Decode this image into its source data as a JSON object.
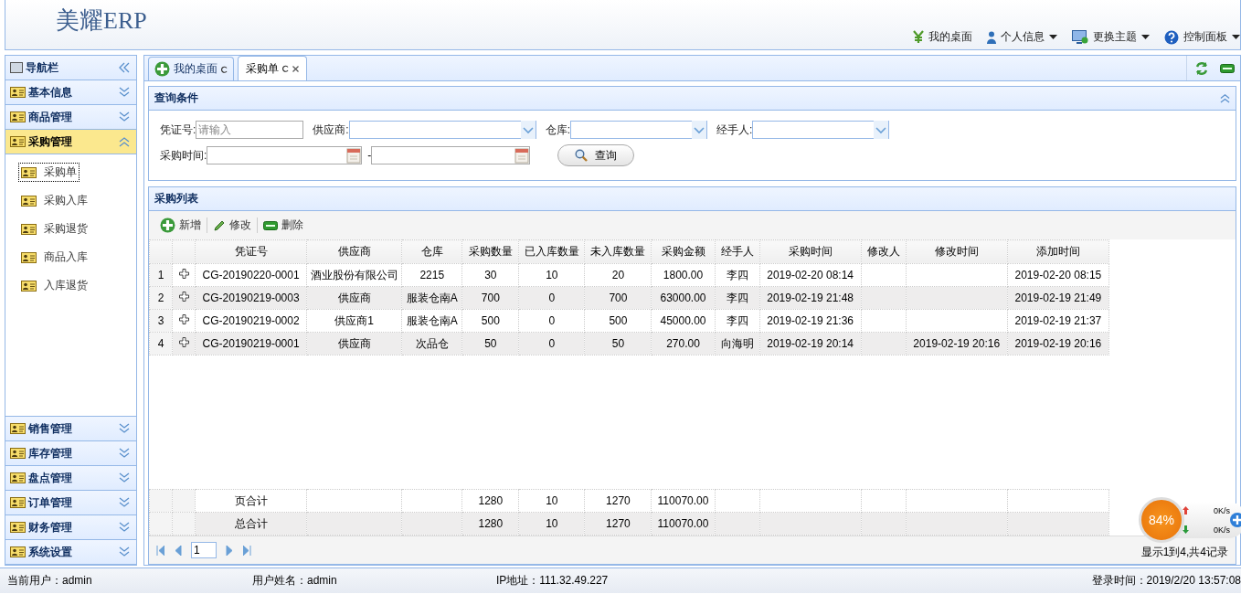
{
  "header": {
    "logo": "美耀ERP",
    "menu": [
      {
        "label": "我的桌面",
        "dropdown": false
      },
      {
        "label": "个人信息",
        "dropdown": true
      },
      {
        "label": "更换主题",
        "dropdown": true
      },
      {
        "label": "控制面板",
        "dropdown": true
      }
    ]
  },
  "sidebar": {
    "title": "导航栏",
    "sections": [
      {
        "label": "基本信息",
        "expanded": false
      },
      {
        "label": "商品管理",
        "expanded": false
      },
      {
        "label": "采购管理",
        "expanded": true,
        "items": [
          {
            "label": "采购单",
            "selected": true
          },
          {
            "label": "采购入库",
            "selected": false
          },
          {
            "label": "采购退货",
            "selected": false
          },
          {
            "label": "商品入库",
            "selected": false
          },
          {
            "label": "入库退货",
            "selected": false
          }
        ]
      },
      {
        "label": "销售管理",
        "expanded": false
      },
      {
        "label": "库存管理",
        "expanded": false
      },
      {
        "label": "盘点管理",
        "expanded": false
      },
      {
        "label": "订单管理",
        "expanded": false
      },
      {
        "label": "财务管理",
        "expanded": false
      },
      {
        "label": "系统设置",
        "expanded": false
      }
    ]
  },
  "tabs": [
    {
      "label": "我的桌面",
      "selected": false,
      "closable": false
    },
    {
      "label": "采购单",
      "selected": true,
      "closable": true
    }
  ],
  "query": {
    "title": "查询条件",
    "fields": [
      {
        "label": "凭证号:",
        "kind": "text",
        "placeholder": "请输入"
      },
      {
        "label": "供应商:",
        "kind": "select"
      },
      {
        "label": "仓库:",
        "kind": "select"
      },
      {
        "label": "经手人:",
        "kind": "select"
      }
    ],
    "date_range": {
      "label": "采购时间:",
      "separator": "-"
    },
    "search_button": "查询"
  },
  "list": {
    "title": "采购列表",
    "toolbar": [
      "新增",
      "修改",
      "删除"
    ],
    "columns": [
      "凭证号",
      "供应商",
      "仓库",
      "采购数量",
      "已入库数量",
      "未入库数量",
      "采购金额",
      "经手人",
      "采购时间",
      "修改人",
      "修改时间",
      "添加时间"
    ],
    "rows": [
      {
        "number": "1",
        "cells": [
          "CG-20190220-0001",
          "酒业股份有限公司",
          "2215",
          "30",
          "10",
          "20",
          "1800.00",
          "李四",
          "2019-02-20 08:14",
          "",
          "",
          "2019-02-20 08:15"
        ]
      },
      {
        "number": "2",
        "cells": [
          "CG-20190219-0003",
          "供应商",
          "服装仓南A",
          "700",
          "0",
          "700",
          "63000.00",
          "李四",
          "2019-02-19 21:48",
          "",
          "",
          "2019-02-19 21:49"
        ]
      },
      {
        "number": "3",
        "cells": [
          "CG-20190219-0002",
          "供应商1",
          "服装仓南A",
          "500",
          "0",
          "500",
          "45000.00",
          "李四",
          "2019-02-19 21:36",
          "",
          "",
          "2019-02-19 21:37"
        ]
      },
      {
        "number": "4",
        "cells": [
          "CG-20190219-0001",
          "供应商",
          "次品仓",
          "50",
          "0",
          "50",
          "270.00",
          "向海明",
          "2019-02-19 20:14",
          "",
          "2019-02-19 20:16",
          "2019-02-19 20:16"
        ]
      }
    ],
    "footer": [
      {
        "cells": [
          "页合计",
          "",
          "",
          "1280",
          "10",
          "1270",
          "110070.00",
          "",
          "",
          "",
          "",
          ""
        ]
      },
      {
        "cells": [
          "总合计",
          "",
          "",
          "1280",
          "10",
          "1270",
          "110070.00",
          "",
          "",
          "",
          "",
          ""
        ]
      }
    ],
    "pager": {
      "page": "1",
      "summary": "显示1到4,共4记录"
    }
  },
  "speed_widget": {
    "percent": "84%",
    "upload": "0K/s",
    "download": "0K/s"
  },
  "status_bar": [
    "当前用户：admin",
    "用户姓名：admin",
    "IP地址：111.32.49.227",
    "登录时间：2019/2/20 13:57:08"
  ]
}
